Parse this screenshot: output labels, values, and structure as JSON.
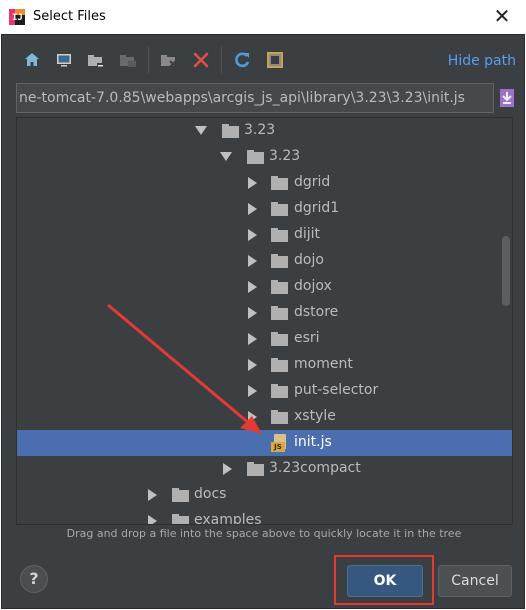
{
  "window": {
    "title": "Select Files",
    "close_glyph": "✕"
  },
  "toolbar": {
    "buttons": [
      "home-icon",
      "desktop-icon",
      "new-folder-icon",
      "new-folder-disabled-icon",
      "collapse-icon",
      "delete-icon",
      "refresh-icon",
      "show-hidden-icon"
    ],
    "hide_path_label": "Hide path"
  },
  "path": {
    "value": "ne-tomcat-7.0.85\\webapps\\arcgis_js_api\\library\\3.23\\3.23\\init.js"
  },
  "tree": {
    "rows": [
      {
        "label": "3.23",
        "expanded": true,
        "type": "folder"
      },
      {
        "label": "3.23",
        "expanded": true,
        "type": "folder"
      },
      {
        "label": "dgrid",
        "type": "folder"
      },
      {
        "label": "dgrid1",
        "type": "folder"
      },
      {
        "label": "dijit",
        "type": "folder"
      },
      {
        "label": "dojo",
        "type": "folder"
      },
      {
        "label": "dojox",
        "type": "folder"
      },
      {
        "label": "dstore",
        "type": "folder"
      },
      {
        "label": "esri",
        "type": "folder"
      },
      {
        "label": "moment",
        "type": "folder"
      },
      {
        "label": "put-selector",
        "type": "folder"
      },
      {
        "label": "xstyle",
        "type": "folder"
      },
      {
        "label": "init.js",
        "type": "file",
        "selected": true
      },
      {
        "label": "3.23compact",
        "type": "folder"
      },
      {
        "label": "docs",
        "type": "folder"
      },
      {
        "label": "examples",
        "type": "folder"
      }
    ],
    "file_badge": "JS"
  },
  "hint": "Drag and drop a file into the space above to quickly locate it in the tree",
  "buttons": {
    "help": "?",
    "ok": "OK",
    "cancel": "Cancel"
  },
  "colors": {
    "accent": "#589df6",
    "selection": "#4b6eaf",
    "annotation": "#e53935"
  }
}
